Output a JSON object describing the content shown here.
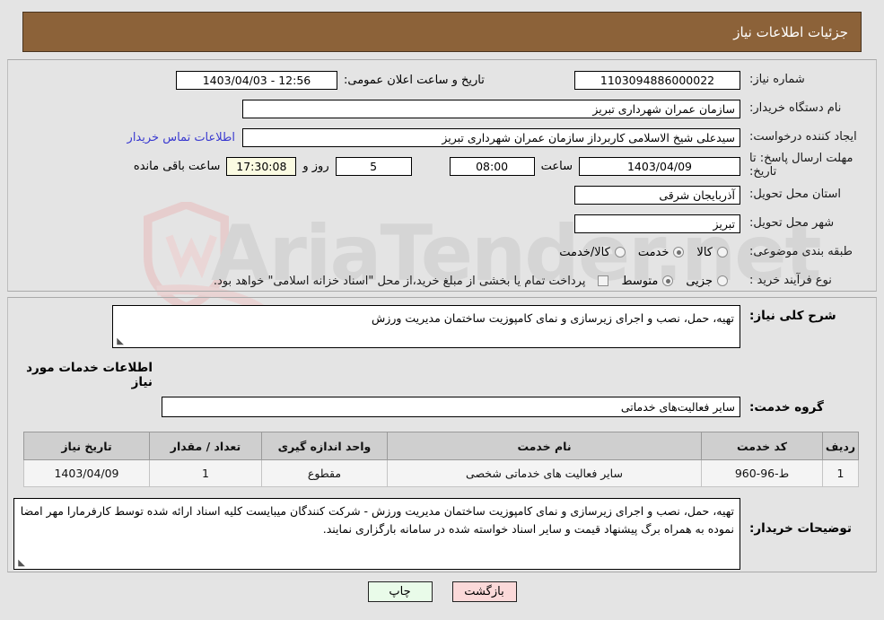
{
  "header": {
    "title": "جزئیات اطلاعات نیاز"
  },
  "watermark": {
    "text": "AriaTender.net",
    "logo_color": "#e8b9b9",
    "text_color": "#c9c9c9"
  },
  "top": {
    "need_number": {
      "label": "شماره نیاز:",
      "value": "1103094886000022"
    },
    "announce_datetime": {
      "label": "تاریخ و ساعت اعلان عمومی:",
      "value": "12:56 - 1403/04/03"
    },
    "buyer_org": {
      "label": "نام دستگاه خریدار:",
      "value": "سازمان عمران شهرداری تبریز"
    },
    "creator": {
      "label": "ایجاد کننده درخواست:",
      "value": "سیدعلی شیخ الاسلامی کاربرداز سازمان عمران شهرداری تبریز"
    },
    "contact_link": {
      "label": "اطلاعات تماس خریدار"
    },
    "deadline": {
      "label": "مهلت ارسال پاسخ: تا تاریخ:",
      "date": "1403/04/09",
      "time_label": "ساعت",
      "time": "08:00",
      "days": "5",
      "days_label": "روز و",
      "countdown": "17:30:08",
      "countdown_label": "ساعت باقی مانده"
    },
    "province": {
      "label": "استان محل تحویل:",
      "value": "آذربایجان شرقی"
    },
    "city": {
      "label": "شهر محل تحویل:",
      "value": "تبریز"
    },
    "category": {
      "label": "طبقه بندی موضوعی:",
      "options": [
        {
          "label": "کالا",
          "selected": false
        },
        {
          "label": "خدمت",
          "selected": true
        },
        {
          "label": "کالا/خدمت",
          "selected": false
        }
      ]
    },
    "purchase_type": {
      "label": "نوع فرآیند خرید :",
      "options": [
        {
          "label": "جزیی",
          "selected": false
        },
        {
          "label": "متوسط",
          "selected": true
        }
      ],
      "treasury_note": "پرداخت تمام یا بخشی از مبلغ خرید،از محل \"اسناد خزانه اسلامی\" خواهد بود.",
      "treasury_checked": false
    }
  },
  "bottom": {
    "need_desc": {
      "label": "شرح کلی نیاز:",
      "value": "تهیه، حمل، نصب و اجرای زیرسازی و نمای کامپوزیت ساختمان مدیریت ورزش"
    },
    "services_section_title": "اطلاعات خدمات مورد نیاز",
    "service_group": {
      "label": "گروه خدمت:",
      "value": "سایر فعالیت‌های خدماتی"
    },
    "table": {
      "columns": [
        "ردیف",
        "کد خدمت",
        "نام خدمت",
        "واحد اندازه گیری",
        "تعداد / مقدار",
        "تاریخ نیاز"
      ],
      "rows": [
        {
          "index": "1",
          "code": "ط-96-960",
          "name": "سایر فعالیت های خدماتی شخصی",
          "unit": "مقطوع",
          "quantity": "1",
          "date": "1403/04/09"
        }
      ]
    },
    "buyer_notes": {
      "label": "توضیحات خریدار:",
      "value": "تهیه، حمل، نصب و اجرای زیرسازی و نمای کامپوزیت ساختمان مدیریت ورزش - شرکت کنندگان میبایست کلیه اسناد ارائه شده توسط کارفرمارا مهر  امضا نموده به همراه برگ پیشنهاد قیمت و سایر اسناد خواسته شده در سامانه بارگزاری نمایند."
    }
  },
  "buttons": {
    "print": "چاپ",
    "back": "بازگشت"
  }
}
